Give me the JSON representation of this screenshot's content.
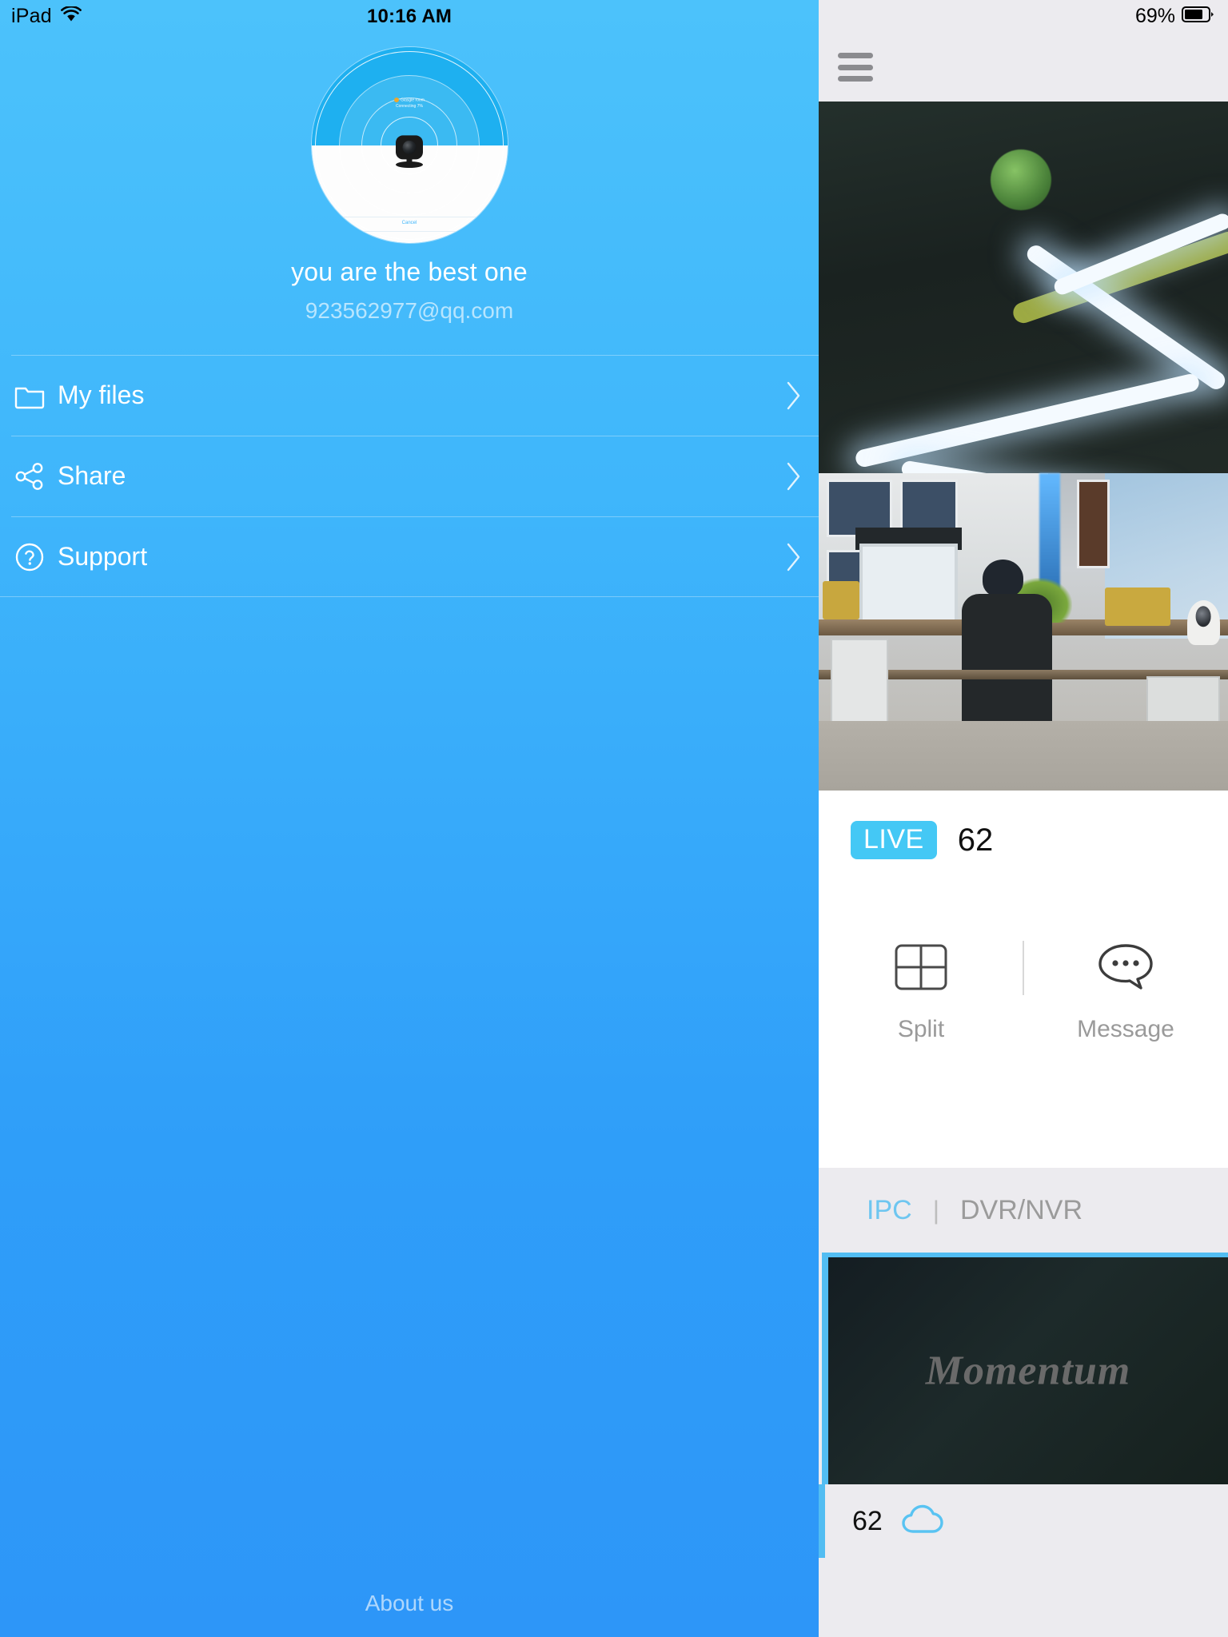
{
  "status_bar": {
    "device": "iPad",
    "wifi_icon": "wifi-icon",
    "time": "10:16 AM",
    "battery_percent": "69%",
    "battery_icon": "battery-icon"
  },
  "drawer": {
    "avatar": {
      "icon": "camera-pairing-avatar",
      "hint_title": "Glasgle room",
      "hint_sub": "Connecting 7%",
      "cancel_label": "Cancel"
    },
    "user_name": "you are the best one",
    "user_email": "923562977@qq.com",
    "menu": [
      {
        "label": "My files",
        "icon": "folder-icon",
        "chevron": "chevron-right-icon"
      },
      {
        "label": "Share",
        "icon": "share-nodes-icon",
        "chevron": "chevron-right-icon"
      },
      {
        "label": "Support",
        "icon": "question-circle-icon",
        "chevron": "chevron-right-icon"
      }
    ],
    "about_label": "About us"
  },
  "panel": {
    "menu_icon": "hamburger-menu-icon",
    "video": {
      "scene": "office-ceiling-live-feed"
    },
    "live": {
      "badge": "LIVE",
      "device_name": "62"
    },
    "actions": [
      {
        "label": "Split",
        "icon": "split-grid-icon"
      },
      {
        "label": "Message",
        "icon": "message-bubble-icon"
      }
    ],
    "tabs": [
      {
        "label": "IPC",
        "active": true
      },
      {
        "label": "DVR/NVR",
        "active": false
      }
    ],
    "tab_divider": "|",
    "device_card": {
      "thumbnail_title": "Momentum",
      "name": "62",
      "cloud_icon": "cloud-icon"
    }
  },
  "colors": {
    "accent_blue": "#44c8f5",
    "drawer_blue": "#3fb6fb",
    "panel_bg": "#ecebef",
    "card_border": "#52bdf2",
    "muted_text": "#9a9a9a"
  }
}
